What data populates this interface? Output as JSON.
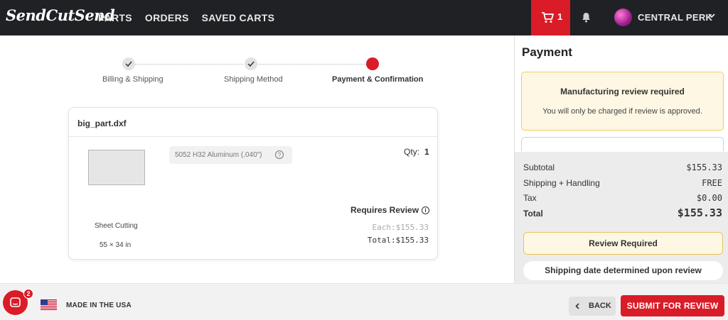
{
  "header": {
    "logo": "SendCutSend",
    "nav": [
      "PARTS",
      "ORDERS",
      "SAVED CARTS"
    ],
    "cart_count": "1",
    "account_name": "CENTRAL PERK"
  },
  "stepper": {
    "steps": [
      {
        "label": "Billing & Shipping",
        "state": "complete"
      },
      {
        "label": "Shipping Method",
        "state": "complete"
      },
      {
        "label": "Payment & Confirmation",
        "state": "active"
      }
    ]
  },
  "part": {
    "filename": "big_part.dxf",
    "material": "5052 H32 Aluminum (.040\")",
    "qty_label": "Qty:",
    "qty": "1",
    "process": "Sheet Cutting",
    "dimensions": "55 × 34 in",
    "review_label": "Requires Review",
    "each_price": "Each:$155.33",
    "total_price": "Total:$155.33"
  },
  "payment": {
    "title": "Payment",
    "notice_title": "Manufacturing review required",
    "notice_body": "You will only be charged if review is approved.",
    "summary": [
      {
        "label": "Subtotal",
        "value": "$155.33"
      },
      {
        "label": "Shipping + Handling",
        "value": "FREE"
      },
      {
        "label": "Tax",
        "value": "$0.00"
      },
      {
        "label": "Total",
        "value": "$155.33"
      }
    ],
    "review_button": "Review Required",
    "ship_date": "Shipping date determined upon review"
  },
  "footer": {
    "chat_badge": "2",
    "made_in": "MADE IN THE USA",
    "back_label": "BACK",
    "submit_label": "SUBMIT FOR REVIEW"
  },
  "colors": {
    "brand_red": "#d91c27",
    "header_bg": "#1f2124",
    "notice_bg": "#fdf7e3",
    "notice_border": "#f1cc5d"
  }
}
